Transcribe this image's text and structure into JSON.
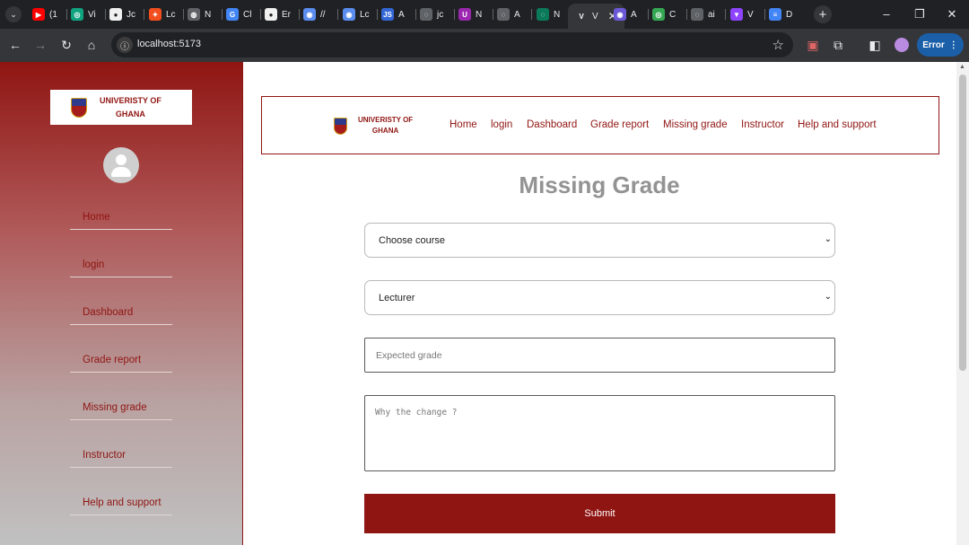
{
  "browser": {
    "tabs": [
      {
        "icon": "youtube-icon",
        "label": "(1",
        "color": "#ff0000",
        "glyph": "▶"
      },
      {
        "icon": "chatgpt-icon",
        "label": "Vi",
        "color": "#10a37f",
        "glyph": "◎"
      },
      {
        "icon": "github-icon",
        "label": "Jc",
        "color": "#f0f0f0",
        "glyph": "●"
      },
      {
        "icon": "figma-icon",
        "label": "Lc",
        "color": "#f24e1e",
        "glyph": "✦"
      },
      {
        "icon": "globe-icon",
        "label": "N",
        "color": "#5f6368",
        "glyph": "◍"
      },
      {
        "icon": "google-icon",
        "label": "Cl",
        "color": "#4285f4",
        "glyph": "G"
      },
      {
        "icon": "github-icon",
        "label": "Er",
        "color": "#f0f0f0",
        "glyph": "●"
      },
      {
        "icon": "app-icon",
        "label": "//",
        "color": "#5b8def",
        "glyph": "◉"
      },
      {
        "icon": "app-icon",
        "label": "Lc",
        "color": "#5b8def",
        "glyph": "◉"
      },
      {
        "icon": "js-icon",
        "label": "A",
        "color": "#3367d6",
        "glyph": "JS"
      },
      {
        "icon": "github-icon",
        "label": "jc",
        "color": "#5f6368",
        "glyph": "◌"
      },
      {
        "icon": "app-icon",
        "label": "N",
        "color": "#9c27b0",
        "glyph": "U"
      },
      {
        "icon": "app-icon",
        "label": "A",
        "color": "#5f6368",
        "glyph": "◌"
      },
      {
        "icon": "app-icon",
        "label": "N",
        "color": "#0b7a5b",
        "glyph": "◌"
      },
      {
        "icon": "vite-icon",
        "label": "V",
        "color": "#35363a",
        "glyph": "V",
        "active": true
      },
      {
        "icon": "app-icon",
        "label": "A",
        "color": "#6b58d6",
        "glyph": "◉"
      },
      {
        "icon": "app-icon",
        "label": "C",
        "color": "#34a853",
        "glyph": "◎"
      },
      {
        "icon": "github-icon",
        "label": "ai",
        "color": "#5f6368",
        "glyph": "◌"
      },
      {
        "icon": "vite-icon",
        "label": "V",
        "color": "#8e44ff",
        "glyph": "▼"
      },
      {
        "icon": "docs-icon",
        "label": "D",
        "color": "#4285f4",
        "glyph": "≡"
      }
    ],
    "url": "localhost:5173",
    "error_label": "Error"
  },
  "sidebar": {
    "logo_line1": "UNIVERISTY OF",
    "logo_line2": "GHANA",
    "items": [
      "Home",
      "login",
      "Dashboard",
      "Grade report",
      "Missing grade",
      "Instructor",
      "Help and support"
    ]
  },
  "topnav": {
    "logo_line1": "UNIVERISTY OF",
    "logo_line2": "GHANA",
    "links": [
      "Home",
      "login",
      "Dashboard",
      "Grade report",
      "Missing grade",
      "Instructor",
      "Help and support"
    ]
  },
  "form": {
    "title": "Missing Grade",
    "course_select": "Choose course",
    "lecturer_select": "Lecturer",
    "expected_grade_placeholder": "Expected grade",
    "reason_placeholder": "Why the change ?",
    "submit_label": "Submit"
  },
  "colors": {
    "brand": "#8f1512",
    "title_gray": "#939393"
  }
}
